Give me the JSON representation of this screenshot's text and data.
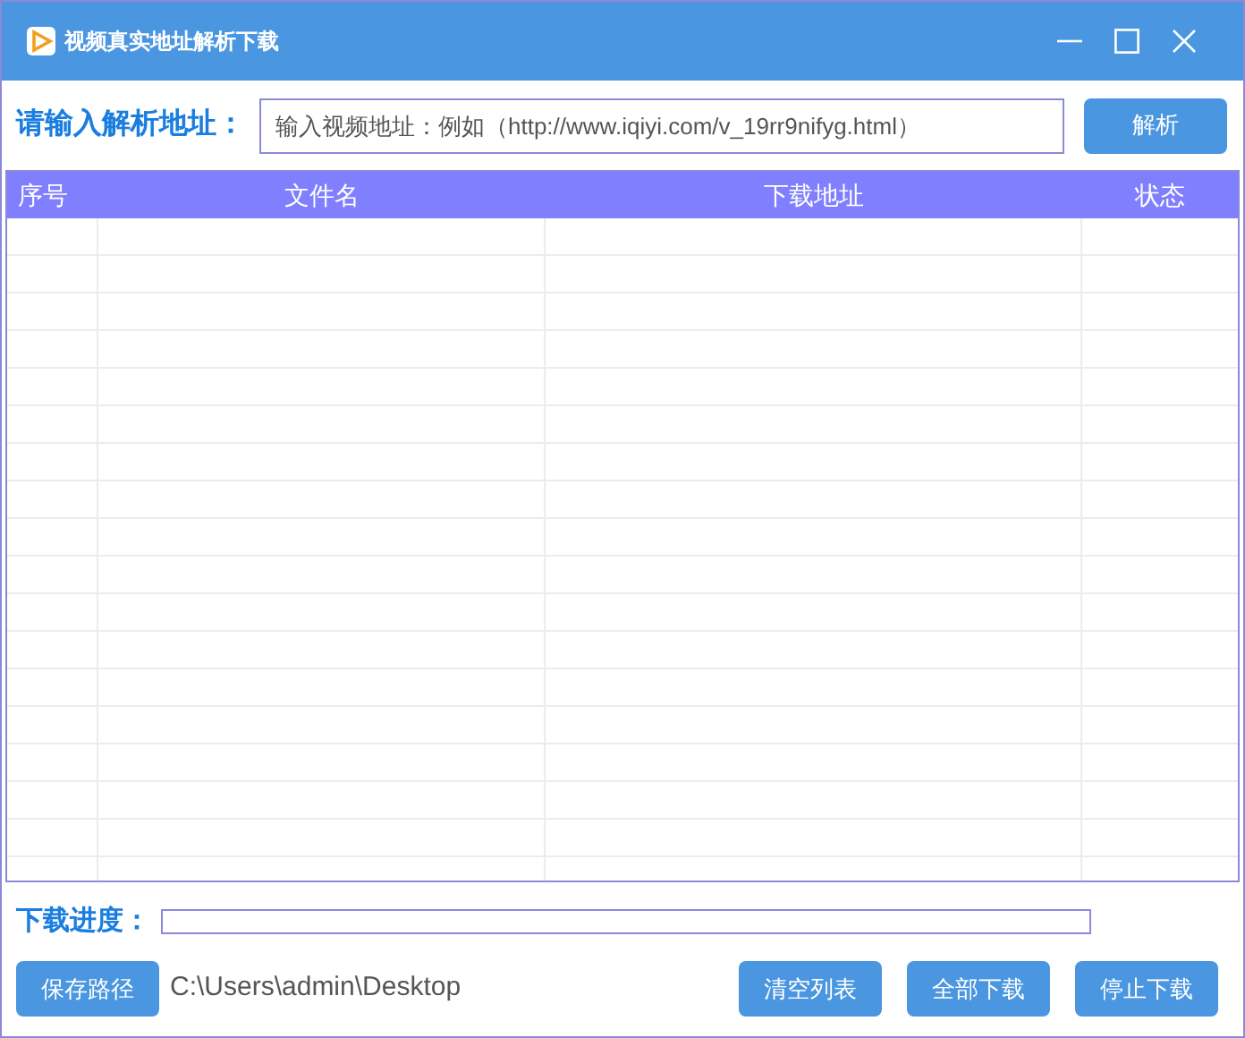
{
  "window": {
    "title": "视频真实地址解析下载"
  },
  "url_label": "请输入解析地址：",
  "url_field": {
    "placeholder": "输入视频地址：例如（http://www.iqiyi.com/v_19rr9nifyg.html）"
  },
  "parse_button": "解析",
  "table": {
    "columns": [
      "序号",
      "文件名",
      "下载地址",
      "状态"
    ]
  },
  "progress": {
    "label": "下载进度：",
    "level": 0
  },
  "save_path_button": "保存路径",
  "save_path": "C:\\Users\\admin\\Desktop",
  "buttons": [
    "清空列表",
    "全部下载",
    "停止下载"
  ]
}
